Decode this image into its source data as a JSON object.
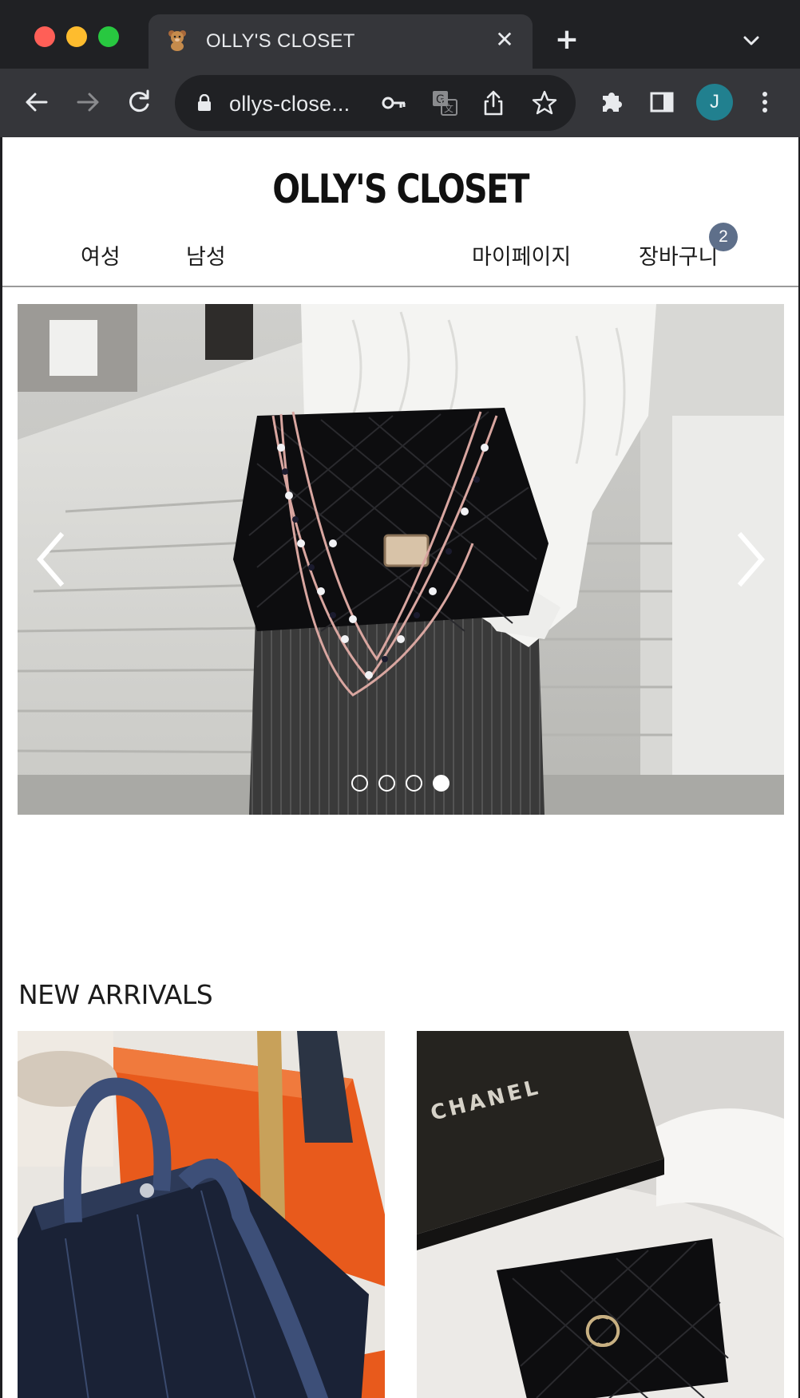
{
  "browser": {
    "tab": {
      "favicon": "teddy-bear",
      "title": "OLLY'S CLOSET",
      "close_label": "✕"
    },
    "new_tab_label": "+",
    "address_bar": {
      "url": "ollys-close..."
    },
    "profile_initial": "J",
    "icons": [
      "back-icon",
      "forward-icon",
      "reload-icon",
      "lock-icon",
      "key-icon",
      "translate-icon",
      "share-icon",
      "star-icon",
      "extensions-icon",
      "sidepanel-icon",
      "kebab-menu-icon",
      "chevron-down-icon"
    ]
  },
  "site": {
    "title": "OLLY'S CLOSET",
    "nav": {
      "women": "여성",
      "men": "남성",
      "mypage": "마이페이지",
      "cart": "장바구니",
      "cart_count": "2"
    }
  },
  "hero": {
    "slide_count": 4,
    "active_slide": 4,
    "image": "black quilted velvet chain bag with pearl strap, white cable knit sweater, pinstripe trousers, stone stairs"
  },
  "new_arrivals": {
    "title": "NEW ARRIVALS",
    "products": [
      {
        "image": "navy canvas tote bag with leather handles on orange box"
      },
      {
        "image": "black caviar card holder with gold logo and black box",
        "box_text": "CHANEL"
      }
    ]
  },
  "colors": {
    "chrome_dark": "#202124",
    "chrome_tab": "#35363a",
    "badge": "#5e6f8a",
    "avatar": "#21808f"
  }
}
